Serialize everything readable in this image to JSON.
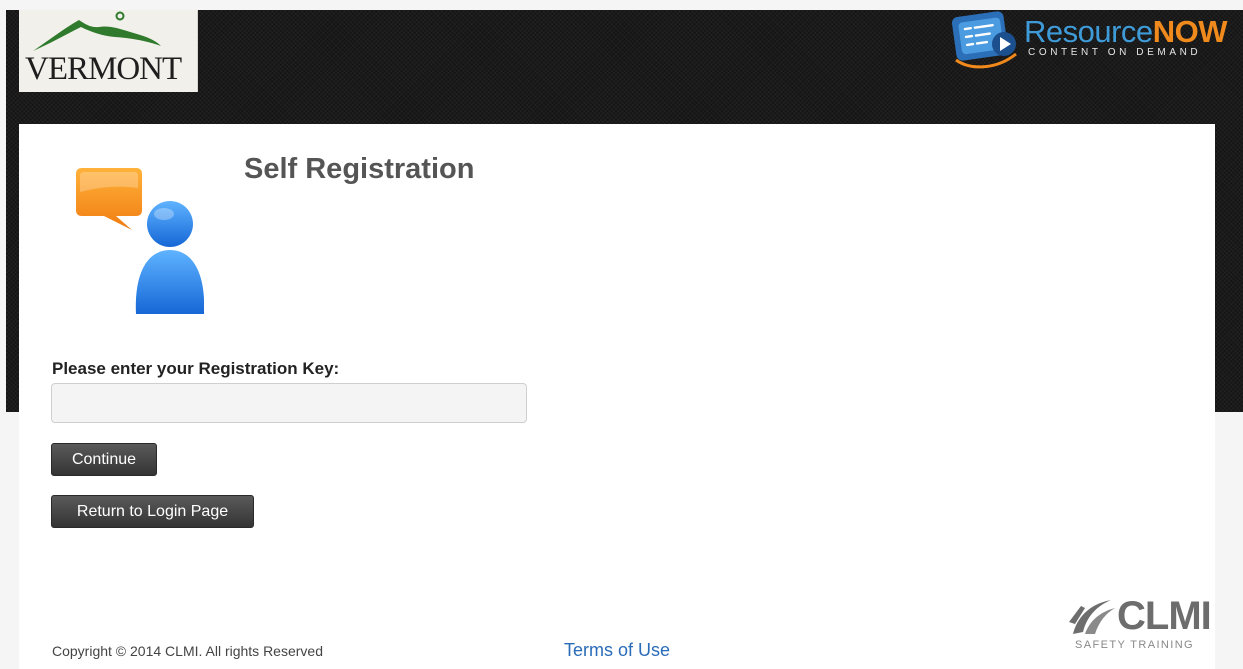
{
  "header": {
    "state_logo_text": "VERMONT",
    "product_logo": {
      "name_part1": "Resource",
      "name_part2": "NOW",
      "tagline": "CONTENT ON DEMAND"
    }
  },
  "main": {
    "title": "Self Registration",
    "registration_key": {
      "label": "Please enter your Registration Key:",
      "value": "",
      "placeholder": ""
    },
    "buttons": {
      "continue": "Continue",
      "return_to_login": "Return to Login Page"
    }
  },
  "footer": {
    "copyright": "Copyright © 2014 CLMI. All rights Reserved",
    "terms_link": "Terms of Use",
    "company_logo": {
      "name": "CLMI",
      "tagline": "SAFETY TRAINING"
    }
  },
  "icons": {
    "registration": "user-chat-icon",
    "product": "resourcenow-logo-icon",
    "state": "vermont-mountains-icon",
    "company": "clmi-swoosh-icon"
  },
  "colors": {
    "header_background": "#151515",
    "title_text": "#555555",
    "button_background": "#3c3c3c",
    "link": "#2a6cb7",
    "brand_blue": "#3f9ad8",
    "brand_orange": "#f08a1c"
  }
}
